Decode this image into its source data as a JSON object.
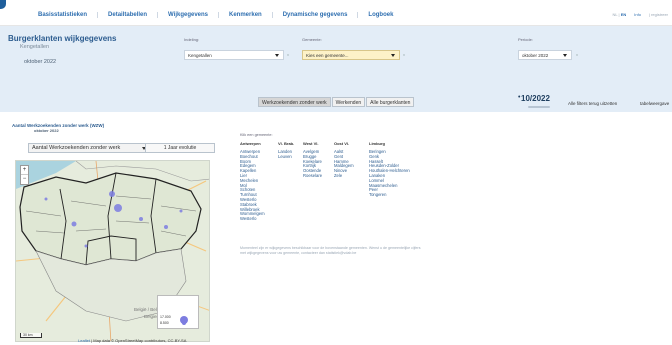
{
  "nav": {
    "items": [
      "Basisstatistieken",
      "Detailtabellen",
      "Wijkgegevens",
      "Kenmerken",
      "Dynamische gegevens",
      "Logboek"
    ],
    "lang_nl": "NL",
    "lang_sep": "|",
    "lang_en": "EN",
    "info": "Info",
    "extra": "|   registreer"
  },
  "header": {
    "title": "Burgerklanten wijkgegevens",
    "subtitle": "Kengetallen",
    "date": "oktober 2022"
  },
  "controls": {
    "indeling_label": "Indeling:",
    "indeling_value": "Kengetallen",
    "gemeente_label": "Gemeente:",
    "gemeente_value": "Kies een gemeente...",
    "periode_label": "Periode:",
    "periode_value": "oktober 2022",
    "periode_selected": "10/2022",
    "clear": "x"
  },
  "tabs": [
    "Werkzoekenden zonder werk",
    "Werkenden",
    "Alle burgerklanten"
  ],
  "actions": {
    "reset": "Alle filters terug uitzetten",
    "table_view": "tabelweergave"
  },
  "map_section": {
    "title": "Aantal Werkzoekenden zonder werk (WZW)",
    "date": "oktober 2022",
    "indicator_select": "Aantal Werkzoekenden zonder werk",
    "evolution_button": "1 Jaar evolutie",
    "legend_values": [
      "17.000",
      "8.500"
    ],
    "scale": "30 km",
    "attribution_leaflet": "Leaflet",
    "attribution_rest": "| Map data © OpenStreetMap contributors, CC-BY-SA",
    "zoom_in": "+",
    "zoom_out": "−"
  },
  "gemeenten": {
    "prompt": "Klik een gemeente:",
    "provinces": [
      {
        "name": "Antwerpen",
        "items": [
          "Antwerpen",
          "Boechout",
          "Boom",
          "Edegem",
          "Kapellen",
          "Lier",
          "Mechelen",
          "Mol",
          "Schoten",
          "Turnhout",
          "Westerlo",
          "Stabroek",
          "Willebroek",
          "Wommelgem",
          "Westerlo"
        ]
      },
      {
        "name": "Vl. Brab.",
        "items": [
          "Landen",
          "Leuven"
        ]
      },
      {
        "name": "West Vl.",
        "items": [
          "Avelgem",
          "Brugge",
          "Koekelare",
          "Kortrijk",
          "Oostende",
          "Roeselare"
        ]
      },
      {
        "name": "Oost Vl.",
        "items": [
          "Aalst",
          "Gent",
          "Hamme",
          "Maldegem",
          "Ninove",
          "Zele"
        ]
      },
      {
        "name": "Limburg",
        "items": [
          "Beringen",
          "Genk",
          "Hasselt",
          "Heusden-Zolder",
          "Houthalen-Helchteren",
          "Lanaken",
          "Lommel",
          "Maasmechelen",
          "Peer",
          "Tongeren"
        ]
      }
    ],
    "note": "Momenteel zijn er wijkgegevens beschikbaar voor de bovenstaande gemeenten. Wenst u de gemeentelijke cijfers met wijkgegevens voor uw gemeente, contacteer dan statistiek@vdab.be"
  }
}
